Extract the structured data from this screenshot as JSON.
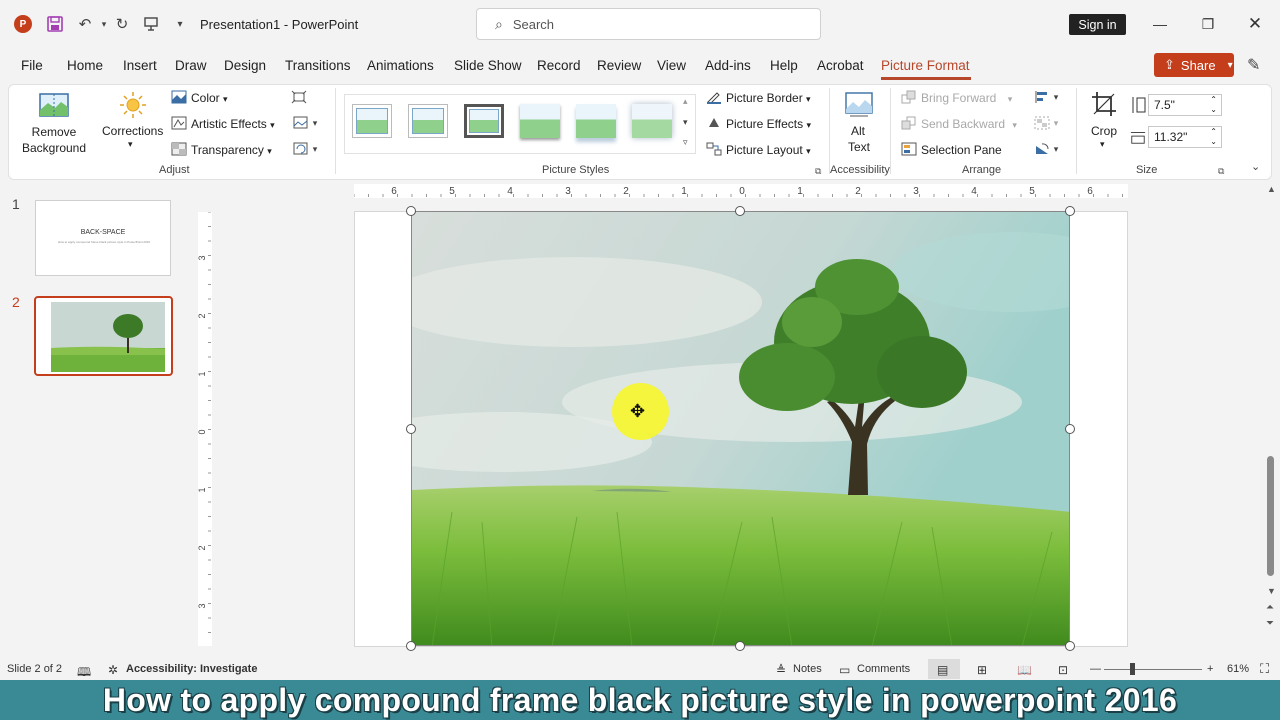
{
  "app": {
    "doc_title": "Presentation1  -  PowerPoint",
    "search_placeholder": "Search",
    "signin_label": "Sign in",
    "logo_letter": "P"
  },
  "menu": {
    "tabs": [
      "File",
      "Home",
      "Insert",
      "Draw",
      "Design",
      "Transitions",
      "Animations",
      "Slide Show",
      "Record",
      "Review",
      "View",
      "Add-ins",
      "Help",
      "Acrobat",
      "Picture Format"
    ],
    "active_tab": "Picture Format",
    "share_label": "Share"
  },
  "ribbon": {
    "remove_bg_label": "Remove Background",
    "corrections_label": "Corrections",
    "color_label": "Color",
    "artistic_label": "Artistic Effects",
    "transparency_label": "Transparency",
    "adjust_group": "Adjust",
    "picture_styles_group": "Picture Styles",
    "picture_border_label": "Picture Border",
    "picture_effects_label": "Picture Effects",
    "picture_layout_label": "Picture Layout",
    "alt_text_label_1": "Alt",
    "alt_text_label_2": "Text",
    "accessibility_group": "Accessibility",
    "bring_forward_label": "Bring Forward",
    "send_backward_label": "Send Backward",
    "selection_pane_label": "Selection Pane",
    "arrange_group": "Arrange",
    "crop_label": "Crop",
    "height_value": "7.5\"",
    "width_value": "11.32\"",
    "size_group": "Size"
  },
  "slides": {
    "items": [
      {
        "number": "1",
        "title": "BACK-SPACE",
        "subtitle": "How to apply compound frame black picture style in PowerPoint 2016"
      },
      {
        "number": "2"
      }
    ]
  },
  "rulers": {
    "top": [
      "6",
      "5",
      "4",
      "3",
      "2",
      "1",
      "0",
      "1",
      "2",
      "3",
      "4",
      "5",
      "6"
    ],
    "left": [
      "3",
      "2",
      "1",
      "0",
      "1",
      "2",
      "3"
    ]
  },
  "status": {
    "slide_info": "Slide 2 of 2",
    "accessibility": "Accessibility: Investigate",
    "notes": "Notes",
    "comments": "Comments",
    "zoom": "61%"
  },
  "caption": {
    "text": "How to apply compound frame black picture style in powerpoint 2016"
  },
  "colors": {
    "accent": "#b7472a",
    "share_bg": "#c43e1c",
    "caption_bg": "#3a8a96"
  }
}
